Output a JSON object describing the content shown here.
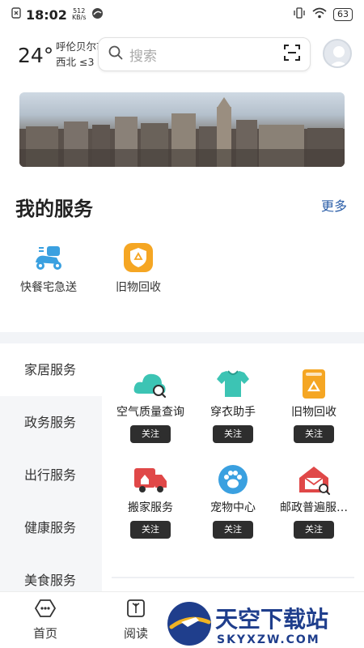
{
  "status_bar": {
    "time": "18:02",
    "net_speed_value": "512",
    "net_speed_unit": "KB/s",
    "battery": "63"
  },
  "header": {
    "temperature": "24°",
    "city": "呼伦贝尔市",
    "wind": "西北 ≤3",
    "search_placeholder": "搜索"
  },
  "my_services": {
    "title": "我的服务",
    "more": "更多",
    "items": [
      {
        "label": "快餐宅急送",
        "icon": "scooter-icon"
      },
      {
        "label": "旧物回收",
        "icon": "recycle-shield-icon"
      }
    ]
  },
  "categories": [
    {
      "label": "家居服务",
      "active": true
    },
    {
      "label": "政务服务",
      "active": false
    },
    {
      "label": "出行服务",
      "active": false
    },
    {
      "label": "健康服务",
      "active": false
    },
    {
      "label": "美食服务",
      "active": false
    }
  ],
  "services": [
    {
      "name": "空气质量查询",
      "action": "关注",
      "icon": "cloud-search-icon"
    },
    {
      "name": "穿衣助手",
      "action": "关注",
      "icon": "shirt-icon"
    },
    {
      "name": "旧物回收",
      "action": "关注",
      "icon": "recycle-bin-icon"
    },
    {
      "name": "搬家服务",
      "action": "关注",
      "icon": "moving-truck-icon"
    },
    {
      "name": "宠物中心",
      "action": "关注",
      "icon": "paw-icon"
    },
    {
      "name": "邮政普遍服…",
      "action": "关注",
      "icon": "mail-house-icon"
    }
  ],
  "bottom_nav": [
    {
      "label": "首页",
      "icon": "home-icon"
    },
    {
      "label": "阅读",
      "icon": "book-icon"
    }
  ],
  "watermark": {
    "text_main": "天空下载站",
    "text_url": "SKYXZW.COM"
  },
  "colors": {
    "accent_link": "#2b5ea8",
    "teal": "#3cc4b4",
    "orange": "#f5a623",
    "red": "#e04848",
    "blue": "#3aa0e0",
    "dark_button": "#2e2e2e"
  }
}
